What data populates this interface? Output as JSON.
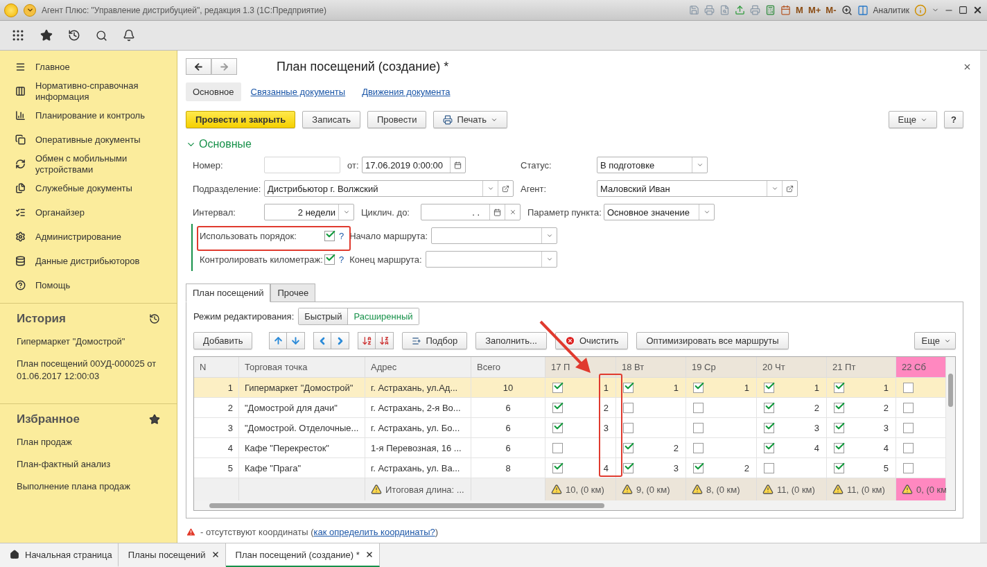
{
  "window": {
    "title": "Агент Плюс: \"Управление дистрибуцией\", редакция 1.3  (1С:Предприятие)",
    "memory_buttons": [
      "M",
      "M+",
      "M-"
    ],
    "user": "Аналитик"
  },
  "sidebar": {
    "items": [
      "Главное",
      "Нормативно-справочная информация",
      "Планирование и контроль",
      "Оперативные документы",
      "Обмен с мобильными устройствами",
      "Служебные документы",
      "Органайзер",
      "Администрирование",
      "Данные дистрибьюторов",
      "Помощь"
    ],
    "history": {
      "title": "История",
      "items": [
        "Гипермаркет \"Домострой\"",
        "План посещений 00УД-000025 от 01.06.2017 12:00:03"
      ]
    },
    "favorites": {
      "title": "Избранное",
      "items": [
        "План продаж",
        "План-фактный анализ",
        "Выполнение плана продаж"
      ]
    }
  },
  "form": {
    "title": "План посещений  (создание) *",
    "tabs": [
      {
        "label": "Основное",
        "selected": true
      },
      {
        "label": "Связанные документы",
        "selected": false
      },
      {
        "label": "Движения документа",
        "selected": false
      }
    ],
    "buttons": [
      {
        "label": "Провести и закрыть",
        "kind": "primary"
      },
      {
        "label": "Записать",
        "kind": "plain"
      },
      {
        "label": "Провести",
        "kind": "plain"
      },
      {
        "label": "Печать",
        "kind": "print"
      }
    ],
    "more": "Еще",
    "help": "?",
    "section": {
      "title": "Основные",
      "expanded": true
    },
    "fields": {
      "number": {
        "label": "Номер:"
      },
      "date": {
        "label": "от:",
        "value": "17.06.2019  0:00:00"
      },
      "status": {
        "label": "Статус:",
        "value": "В подготовке"
      },
      "division": {
        "label": "Подразделение:",
        "value": "Дистрибьютор г. Волжский"
      },
      "agent": {
        "label": "Агент:",
        "value": "Маловский Иван"
      },
      "interval": {
        "label": "Интервал:",
        "value": "2 недели"
      },
      "cyclic_until": {
        "label": "Циклич. до:",
        "value": ".   ."
      },
      "point_param": {
        "label": "Параметр пункта:",
        "value": "Основное значение"
      },
      "use_order": {
        "label": "Использовать порядок:",
        "checked": true,
        "help": "?"
      },
      "route_start": {
        "label": "Начало маршрута:"
      },
      "control_mileage": {
        "label": "Контролировать километраж:",
        "checked": true,
        "help": "?"
      },
      "route_end": {
        "label": "Конец маршрута:"
      }
    }
  },
  "plan": {
    "tabs": [
      {
        "label": "План посещений",
        "selected": true
      },
      {
        "label": "Прочее",
        "selected": false
      }
    ],
    "edit_mode": {
      "label": "Режим редактирования:",
      "options": [
        {
          "label": "Быстрый",
          "selected": false
        },
        {
          "label": "Расширенный",
          "selected": true
        }
      ]
    },
    "toolbar": {
      "add": "Добавить",
      "pick": "Подбор",
      "fill": "Заполнить...",
      "clear": "Очистить",
      "optimize": "Оптимизировать все маршруты",
      "more": "Еще"
    },
    "columns": [
      "N",
      "Торговая точка",
      "Адрес",
      "Всего"
    ],
    "days": [
      {
        "label": "17 П",
        "color": "#ece5d9"
      },
      {
        "label": "18 Вт",
        "color": "#ece5d9"
      },
      {
        "label": "19 Ср",
        "color": "#ece5d9"
      },
      {
        "label": "20 Чт",
        "color": "#ece5d9"
      },
      {
        "label": "21 Пт",
        "color": "#ece5d9"
      },
      {
        "label": "22 Сб",
        "color": "#ff88c0"
      }
    ],
    "rows": [
      {
        "n": "1",
        "name": "Гипермаркет \"Домострой\"",
        "address": "г. Астрахань, ул.Ад...",
        "total": "10",
        "selected": true,
        "days": [
          {
            "checked": true,
            "order": "1"
          },
          {
            "checked": true,
            "order": "1"
          },
          {
            "checked": true,
            "order": "1"
          },
          {
            "checked": true,
            "order": "1"
          },
          {
            "checked": true,
            "order": "1"
          },
          {
            "checked": false
          }
        ]
      },
      {
        "n": "2",
        "name": "\"Домострой для дачи\"",
        "address": "г. Астрахань, 2-я Во...",
        "total": "6",
        "selected": false,
        "days": [
          {
            "checked": true,
            "order": "2"
          },
          {
            "checked": false
          },
          {
            "checked": false
          },
          {
            "checked": true,
            "order": "2"
          },
          {
            "checked": true,
            "order": "2"
          },
          {
            "checked": false
          }
        ]
      },
      {
        "n": "3",
        "name": "\"Домострой. Отделочные...",
        "address": "г. Астрахань, ул. Бо...",
        "total": "6",
        "selected": false,
        "days": [
          {
            "checked": true,
            "order": "3"
          },
          {
            "checked": false
          },
          {
            "checked": false
          },
          {
            "checked": true,
            "order": "3"
          },
          {
            "checked": true,
            "order": "3"
          },
          {
            "checked": false
          }
        ]
      },
      {
        "n": "4",
        "name": "Кафе \"Перекресток\"",
        "address": "1-я Перевозная, 16 ...",
        "total": "6",
        "selected": false,
        "days": [
          {
            "checked": false
          },
          {
            "checked": true,
            "order": "2"
          },
          {
            "checked": false
          },
          {
            "checked": true,
            "order": "4"
          },
          {
            "checked": true,
            "order": "4"
          },
          {
            "checked": false
          }
        ]
      },
      {
        "n": "5",
        "name": "Кафе \"Прага\"",
        "address": "г. Астрахань, ул. Ва...",
        "total": "8",
        "selected": false,
        "days": [
          {
            "checked": true,
            "order": "4"
          },
          {
            "checked": true,
            "order": "3"
          },
          {
            "checked": true,
            "order": "2"
          },
          {
            "checked": false
          },
          {
            "checked": true,
            "order": "5"
          },
          {
            "checked": false
          }
        ]
      }
    ],
    "footer": {
      "address": "Итоговая длина: ...",
      "days": [
        "10, (0 км)",
        "9, (0 км)",
        "8, (0 км)",
        "11, (0 км)",
        "11, (0 км)",
        "0, (0 км"
      ]
    }
  },
  "note": {
    "text": "- отсутствуют координаты (",
    "link": "как определить координаты?",
    "tail": ")"
  },
  "taskbar": [
    {
      "label": "Начальная страница",
      "kind": "home",
      "selected": false
    },
    {
      "label": "Планы посещений",
      "kind": "doc",
      "selected": false
    },
    {
      "label": "План посещений  (создание) *",
      "kind": "doc",
      "selected": true
    }
  ]
}
